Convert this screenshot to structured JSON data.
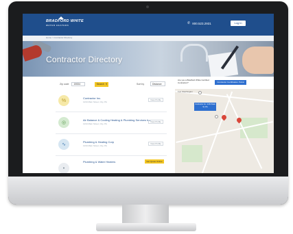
{
  "header": {
    "brand_name": "BRADFORD WHITE",
    "brand_tagline": "WATER HEATERS",
    "phone_number": "800.523.2931",
    "login_label": "Log In"
  },
  "breadcrumb": {
    "text": "Home  >  Contractor Directory"
  },
  "hero": {
    "title": "Contractor Directory"
  },
  "filters": {
    "zip_label": "Zip code",
    "zip_value": "19004",
    "search_label": "Search",
    "sort_label": "Sort by",
    "sort_value": "Distance"
  },
  "listings": [
    {
      "title": "Contractor Inc.",
      "subtitle": "1234 Main Street, City, PA",
      "button": "View Profile",
      "icon_color": "#f6e9a8",
      "icon_glyph": "%"
    },
    {
      "title": "Air Balance & Cooling Heating & Plumbing Services Inc.",
      "subtitle": "1234 Main Street, City, PA",
      "button": "View Profile",
      "icon_color": "#d4ead0",
      "icon_glyph": "◎"
    },
    {
      "title": "Plumbing & Heating Corp",
      "subtitle": "1234 Main Street, City, PA",
      "button": "View Profile",
      "icon_color": "#d6e6f2",
      "icon_glyph": "∿"
    },
    {
      "title": "Plumbing & Water Heaters",
      "subtitle": "",
      "button": "Get Quote Online",
      "icon_color": "#e9ecf0",
      "icon_glyph": "•"
    }
  ],
  "map": {
    "question": "Are you a Bradford White Certified Contractor?",
    "cta_label": "Contractor Certification Portal",
    "place_label": "Fort Washington",
    "info_box": "Contractor Inc. 1234 Main St, PA",
    "colors": {
      "water": "#b7d3ea",
      "park": "#d6e8cc",
      "pin": "#d9473a"
    }
  },
  "colors": {
    "brand_blue": "#1f4e8c",
    "accent_yellow": "#f3c623",
    "link_blue": "#2e6fcf"
  }
}
